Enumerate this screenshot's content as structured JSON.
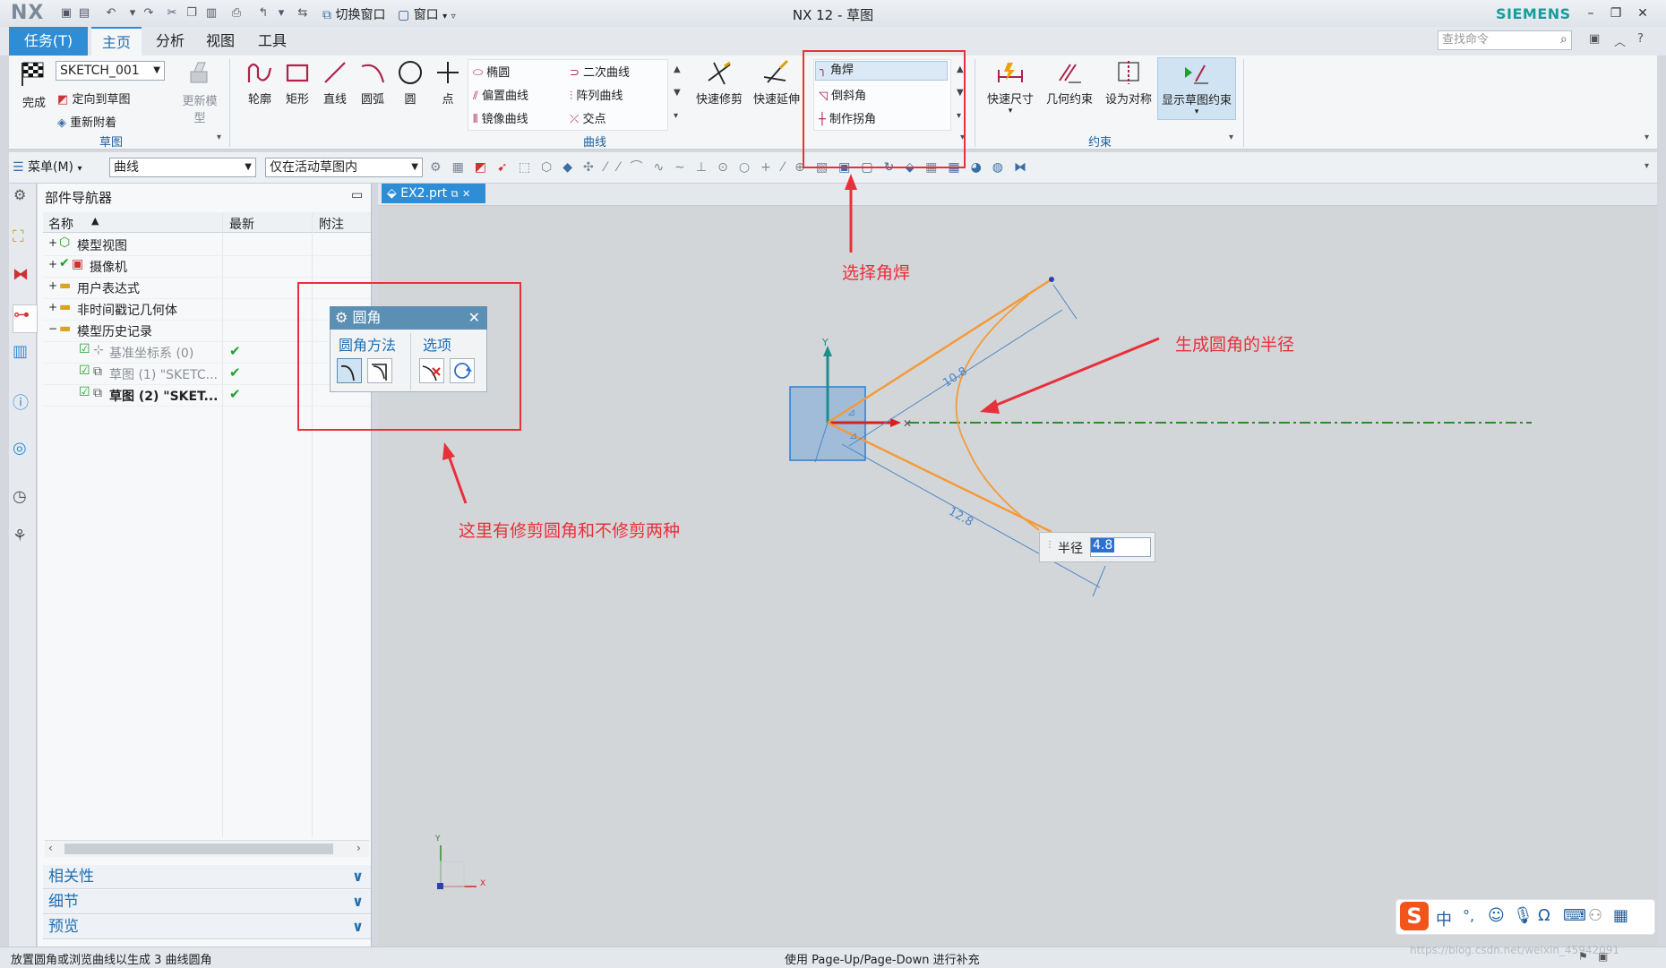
{
  "window": {
    "logo": "NX",
    "title": "NX 12 - 草图",
    "brand": "SIEMENS",
    "switch_window": "切换窗口",
    "window_menu": "窗口"
  },
  "tabs": [
    {
      "label": "任务(T)"
    },
    {
      "label": "主页"
    },
    {
      "label": "分析"
    },
    {
      "label": "视图"
    },
    {
      "label": "工具"
    }
  ],
  "search": {
    "placeholder": "查找命令"
  },
  "ribbon": {
    "sketch_group": {
      "finish": "完成",
      "sketch_name": "SKETCH_001",
      "orient": "定向到草图",
      "reattach": "重新附着",
      "update_model": "更新模型",
      "label": "草图"
    },
    "curve_group": {
      "profile": "轮廓",
      "rectangle": "矩形",
      "line": "直线",
      "arc": "圆弧",
      "circle": "圆",
      "point": "点",
      "ellipse": "椭圆",
      "conic": "二次曲线",
      "offset_curve": "偏置曲线",
      "pattern_curve": "阵列曲线",
      "mirror_curve": "镜像曲线",
      "intersection": "交点",
      "quick_trim": "快速修剪",
      "quick_extend": "快速延伸",
      "fillet": "角焊",
      "chamfer": "倒斜角",
      "make_corner": "制作拐角",
      "label": "曲线"
    },
    "constraint_group": {
      "rapid_dimension": "快速尺寸",
      "geometric_constraint": "几何约束",
      "make_symmetric": "设为对称",
      "show_constraints": "显示草图约束",
      "label": "约束"
    }
  },
  "toolbar2": {
    "menu": "菜单(M)",
    "filter": "曲线",
    "scope": "仅在活动草图内"
  },
  "navigator": {
    "title": "部件导航器",
    "columns": [
      "名称",
      "最新",
      "附注"
    ],
    "rows": [
      {
        "label": "模型视图",
        "check": ""
      },
      {
        "label": "摄像机",
        "check": ""
      },
      {
        "label": "用户表达式",
        "check": ""
      },
      {
        "label": "非时间戳记几何体",
        "check": ""
      },
      {
        "label": "模型历史记录",
        "check": ""
      },
      {
        "label": "基准坐标系 (0)",
        "check": "✔"
      },
      {
        "label": "草图 (1) \"SKETC...",
        "check": "✔"
      },
      {
        "label": "草图 (2) \"SKET...",
        "check": "✔"
      }
    ],
    "panels": [
      "相关性",
      "细节",
      "预览"
    ]
  },
  "document": {
    "tab": "EX2.prt"
  },
  "dialog": {
    "title": "圆角",
    "method_label": "圆角方法",
    "options_label": "选项"
  },
  "sketch": {
    "dim_upper": "10.8",
    "dim_lower": "12.8",
    "radius_label": "半径",
    "radius_value": "4.8",
    "axis_x": "X",
    "axis_y": "Y"
  },
  "annotations": {
    "select_fillet": "选择角焊",
    "radius_note": "生成圆角的半径",
    "trim_note": "这里有修剪圆角和不修剪两种",
    "color": "#e8303a"
  },
  "status": {
    "left": "放置圆角或浏览曲线以生成 3 曲线圆角",
    "center": "使用 Page-Up/Page-Down 进行补充",
    "watermark": "https://blog.csdn.net/weixin_45942091"
  },
  "ime": {
    "mode": "中"
  }
}
